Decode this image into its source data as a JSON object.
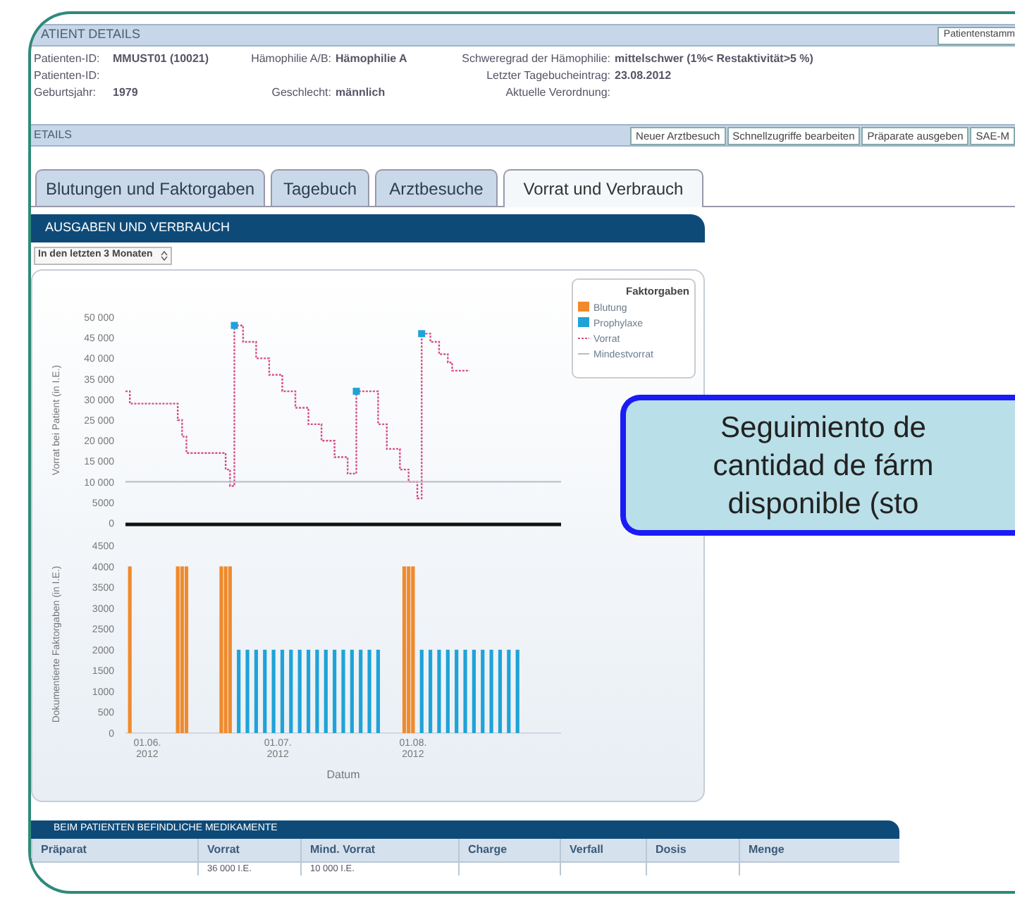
{
  "header": {
    "title": "ATIENT DETAILS",
    "button": "Patientenstamm"
  },
  "patient_info": [
    {
      "left": {
        "label": "Patienten-ID:",
        "value": "MMUST01 (10021)"
      },
      "middle": {
        "label": "Hämophilie A/B:",
        "value": "Hämophilie A"
      },
      "right": {
        "label": "Schweregrad der Hämophilie:",
        "value": "mittelschwer (1%< Restaktivität>5 %)"
      }
    },
    {
      "left": {
        "label": "Patienten-ID:"
      },
      "right": {
        "label": "Letzter Tagebucheintrag:",
        "value": "23.08.2012"
      }
    },
    {
      "left": {
        "label": "Geburtsjahr:",
        "value": "1979"
      },
      "middle": {
        "label": "Geschlecht:",
        "value": "männlich"
      },
      "right": {
        "label": "Aktuelle Verordnung:"
      }
    }
  ],
  "details_bar": {
    "title": "ETAILS",
    "buttons": [
      "Neuer Arztbesuch",
      "Schnellzugriffe bearbeiten",
      "Präparate ausgeben",
      "SAE-M"
    ]
  },
  "tabs": [
    {
      "label": "Blutungen und Faktorgaben",
      "selected": false
    },
    {
      "label": "Tagebuch",
      "selected": false
    },
    {
      "label": "Arztbesuche",
      "selected": false
    },
    {
      "label": "Vorrat und Verbrauch",
      "selected": true
    }
  ],
  "panel": {
    "title": "AUSGABEN UND VERBRAUCH",
    "period_select": "In den letzten 3 Monaten",
    "legend_title": "Faktorgaben",
    "stock_chart": {
      "chart_data": {
        "type": "line",
        "legend": "top-right",
        "ylabel": "Vorrat bei Patient (in I.E.)",
        "ylim": [
          0,
          50000
        ],
        "yticks": [
          {
            "value": 0,
            "label": "0"
          },
          {
            "value": 5000,
            "label": "5000"
          },
          {
            "value": 10000,
            "label": "10 000"
          },
          {
            "value": 15000,
            "label": "15 000"
          },
          {
            "value": 20000,
            "label": "20 000"
          },
          {
            "value": 25000,
            "label": "25 000"
          },
          {
            "value": 30000,
            "label": "30 000"
          },
          {
            "value": 35000,
            "label": "35 000"
          },
          {
            "value": 40000,
            "label": "40 000"
          },
          {
            "value": 45000,
            "label": "45 000"
          },
          {
            "value": 50000,
            "label": "50 000"
          }
        ],
        "categories": [
          null,
          null,
          null,
          null,
          null,
          null,
          null,
          null,
          null,
          null,
          null,
          null,
          null,
          null,
          null,
          null,
          null,
          null,
          null,
          null,
          null,
          null,
          null,
          null,
          null,
          null,
          null,
          null,
          null,
          null,
          null,
          null,
          null,
          null,
          null,
          null,
          null,
          null,
          null,
          null,
          null,
          null,
          null,
          null,
          null,
          null,
          null,
          null,
          null,
          null,
          null,
          null,
          null,
          null,
          null,
          null,
          null,
          null,
          null,
          null,
          null,
          null,
          null,
          null,
          null,
          null,
          null,
          null,
          null,
          null,
          null,
          null,
          null,
          null,
          null,
          null,
          null,
          null,
          null,
          null,
          null,
          null,
          null,
          null,
          null,
          null,
          null,
          null,
          null,
          null,
          null,
          null,
          null,
          null,
          null,
          null,
          null,
          null,
          null,
          null,
          null
        ],
        "series": [
          {
            "name": "Vorrat",
            "color": "#d64f8c",
            "line_style": "dashed",
            "values": [
              32000,
              29000,
              29000,
              29000,
              29000,
              29000,
              29000,
              29000,
              29000,
              29000,
              29000,
              29000,
              25000,
              21000,
              17000,
              17000,
              17000,
              17000,
              17000,
              17000,
              17000,
              17000,
              17000,
              13000,
              9000,
              48000,
              48000,
              44000,
              44000,
              44000,
              40000,
              40000,
              40000,
              36000,
              36000,
              36000,
              32000,
              32000,
              32000,
              28000,
              28000,
              28000,
              24000,
              24000,
              24000,
              20000,
              20000,
              20000,
              16000,
              16000,
              16000,
              12000,
              12000,
              32000,
              32000,
              32000,
              32000,
              32000,
              24000,
              24000,
              18000,
              18000,
              18000,
              13000,
              13000,
              10000,
              10000,
              6000,
              46000,
              46000,
              44000,
              44000,
              41000,
              41000,
              39000,
              37000,
              37000,
              37000,
              37000,
              37000,
              null,
              null,
              null,
              null,
              null,
              null,
              null,
              null,
              null,
              null,
              null,
              null,
              null,
              null,
              null,
              null,
              null,
              null,
              null,
              null,
              null
            ]
          },
          {
            "name": "Mindestvorrat",
            "color": "#b8bcc4",
            "line_style": "solid",
            "values": [
              10000,
              10000,
              10000,
              10000,
              10000,
              10000,
              10000,
              10000,
              10000,
              10000,
              10000,
              10000,
              10000,
              10000,
              10000,
              10000,
              10000,
              10000,
              10000,
              10000,
              10000,
              10000,
              10000,
              10000,
              10000,
              10000,
              10000,
              10000,
              10000,
              10000,
              10000,
              10000,
              10000,
              10000,
              10000,
              10000,
              10000,
              10000,
              10000,
              10000,
              10000,
              10000,
              10000,
              10000,
              10000,
              10000,
              10000,
              10000,
              10000,
              10000,
              10000,
              10000,
              10000,
              10000,
              10000,
              10000,
              10000,
              10000,
              10000,
              10000,
              10000,
              10000,
              10000,
              10000,
              10000,
              10000,
              10000,
              10000,
              10000,
              10000,
              10000,
              10000,
              10000,
              10000,
              10000,
              10000,
              10000,
              10000,
              10000,
              10000,
              10000,
              10000,
              10000,
              10000,
              10000,
              10000,
              10000,
              10000,
              10000,
              10000,
              10000,
              10000,
              10000,
              10000,
              10000,
              10000,
              10000,
              10000,
              10000,
              10000,
              10000
            ]
          }
        ]
      }
    },
    "doses_chart": {
      "chart_data": {
        "type": "bar",
        "ylabel": "Dokumentierte Faktorgaben (in I.E.)",
        "xlabel": "Datum",
        "ylim": [
          0,
          4500
        ],
        "yticks": [
          0,
          500,
          1000,
          1500,
          2000,
          2500,
          3000,
          3500,
          4000,
          4500
        ],
        "categories": [
          null,
          null,
          null,
          null,
          null,
          "01.06. 2012",
          null,
          null,
          null,
          null,
          null,
          null,
          null,
          null,
          null,
          null,
          null,
          null,
          null,
          null,
          null,
          null,
          null,
          null,
          null,
          null,
          null,
          null,
          null,
          null,
          null,
          null,
          null,
          null,
          null,
          "01.07. 2012",
          null,
          null,
          null,
          null,
          null,
          null,
          null,
          null,
          null,
          null,
          null,
          null,
          null,
          null,
          null,
          null,
          null,
          null,
          null,
          null,
          null,
          null,
          null,
          null,
          null,
          null,
          null,
          null,
          null,
          null,
          "01.08. 2012",
          null,
          null,
          null,
          null,
          null,
          null,
          null,
          null,
          null,
          null,
          null,
          null,
          null,
          null,
          null,
          null,
          null,
          null,
          null,
          null,
          null,
          null,
          null,
          null,
          null,
          null,
          null,
          null,
          null,
          null,
          null,
          null,
          null,
          null
        ],
        "stacked": true,
        "series": [
          {
            "name": "Blutung",
            "color": "#f08a2c",
            "values": [
              null,
              4000,
              null,
              null,
              null,
              null,
              null,
              null,
              null,
              null,
              null,
              null,
              4000,
              4000,
              4000,
              null,
              null,
              null,
              null,
              null,
              null,
              null,
              4000,
              4000,
              4000,
              null,
              null,
              null,
              null,
              null,
              null,
              null,
              null,
              null,
              null,
              null,
              null,
              null,
              null,
              null,
              null,
              null,
              null,
              null,
              null,
              null,
              null,
              null,
              null,
              null,
              null,
              null,
              null,
              null,
              null,
              null,
              null,
              null,
              null,
              null,
              null,
              null,
              null,
              null,
              4000,
              4000,
              4000,
              null,
              null,
              null,
              null,
              null,
              null,
              null,
              null,
              null,
              null,
              null,
              null,
              null,
              null,
              null,
              null,
              null,
              null,
              null,
              null,
              null,
              null,
              null,
              null,
              null,
              null,
              null,
              null,
              null,
              null,
              null,
              null,
              null,
              null
            ]
          },
          {
            "name": "Prophylaxe",
            "color": "#1ea3d8",
            "values": [
              null,
              null,
              null,
              null,
              null,
              null,
              null,
              null,
              null,
              null,
              null,
              null,
              null,
              null,
              null,
              null,
              null,
              null,
              null,
              null,
              null,
              null,
              null,
              null,
              null,
              null,
              2000,
              null,
              2000,
              null,
              2000,
              null,
              2000,
              null,
              2000,
              null,
              2000,
              null,
              2000,
              null,
              2000,
              null,
              2000,
              null,
              2000,
              null,
              2000,
              null,
              2000,
              null,
              2000,
              null,
              2000,
              null,
              2000,
              null,
              2000,
              null,
              2000,
              null,
              null,
              null,
              null,
              null,
              null,
              null,
              null,
              null,
              2000,
              null,
              2000,
              null,
              2000,
              null,
              2000,
              null,
              2000,
              null,
              2000,
              null,
              2000,
              null,
              2000,
              null,
              2000,
              null,
              2000,
              null,
              2000,
              null,
              2000,
              null,
              null,
              null,
              null,
              null,
              null,
              null,
              null,
              null,
              null
            ]
          }
        ]
      }
    }
  },
  "medications": {
    "title": "BEIM PATIENTEN BEFINDLICHE MEDIKAMENTE",
    "columns": [
      "Präparat",
      "Vorrat",
      "Mind. Vorrat",
      "Charge",
      "Verfall",
      "Dosis",
      "Menge"
    ],
    "rows": [
      [
        "",
        "36 000 I.E.",
        "10 000 I.E.",
        "",
        "",
        "",
        ""
      ]
    ]
  },
  "callout": {
    "lines": [
      "Seguimiento de",
      "cantidad de fárm",
      "disponible (sto"
    ]
  }
}
